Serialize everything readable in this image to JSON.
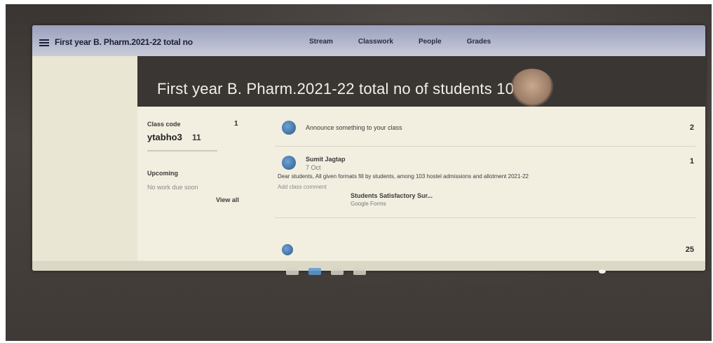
{
  "window": {
    "title": "First year B. Pharm.2021-22 total no"
  },
  "tabs": [
    {
      "label": "Stream"
    },
    {
      "label": "Classwork"
    },
    {
      "label": "People"
    },
    {
      "label": "Grades"
    }
  ],
  "banner": {
    "title": "First year B. Pharm.2021-22 total no of students 103"
  },
  "left_panel": {
    "class_code_label": "Class code",
    "class_code_value": "ytabho3",
    "class_code_count": "1",
    "upcoming_label": "Upcoming",
    "upcoming_note": "No work due soon",
    "view_all": "View all"
  },
  "stream": {
    "posts": [
      {
        "text": "Announce something to your class",
        "count": "2"
      },
      {
        "author": "Sumit Jagtap",
        "time": "7 Oct",
        "body": "Dear students, All given formats fill by students, among 103 hostel admissions and allotment 2021-22",
        "reply": "Add class comment",
        "count": "1"
      },
      {
        "attachment_title": "Students Satisfactory Sur...",
        "attachment_sub": "Google Forms",
        "count": "25"
      }
    ]
  },
  "colors": {
    "banner_bg": "#3a3633",
    "topbar_bg": "#9aa0bd",
    "page_bg": "#f2efe1"
  }
}
